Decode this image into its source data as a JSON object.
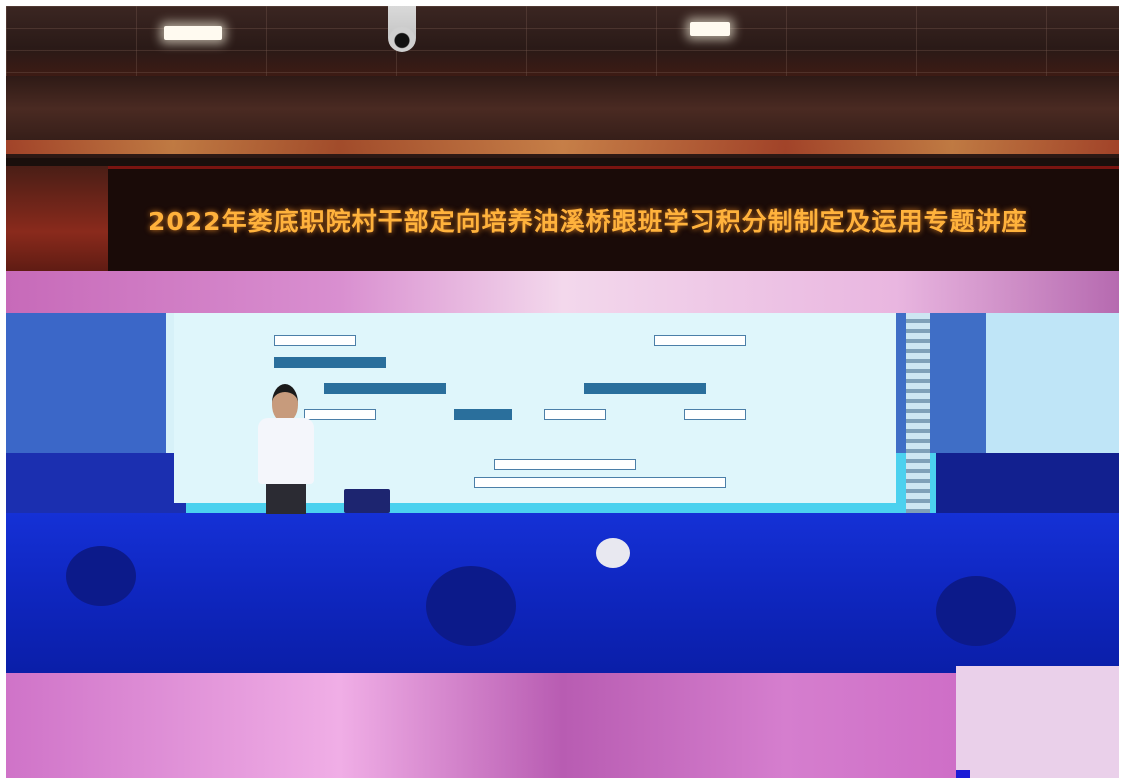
{
  "banner": {
    "text": "2022年娄底职院村干部定向培养油溪桥跟班学习积分制制定及运用专题讲座",
    "color": "#ffb23c",
    "background": "#1a0b08"
  },
  "scene": {
    "description_colors": {
      "ceiling": "#3b2622",
      "screen": "#dff6fb",
      "glitch_blue": "#1531d6",
      "glitch_pink": "#d98fd0"
    }
  }
}
